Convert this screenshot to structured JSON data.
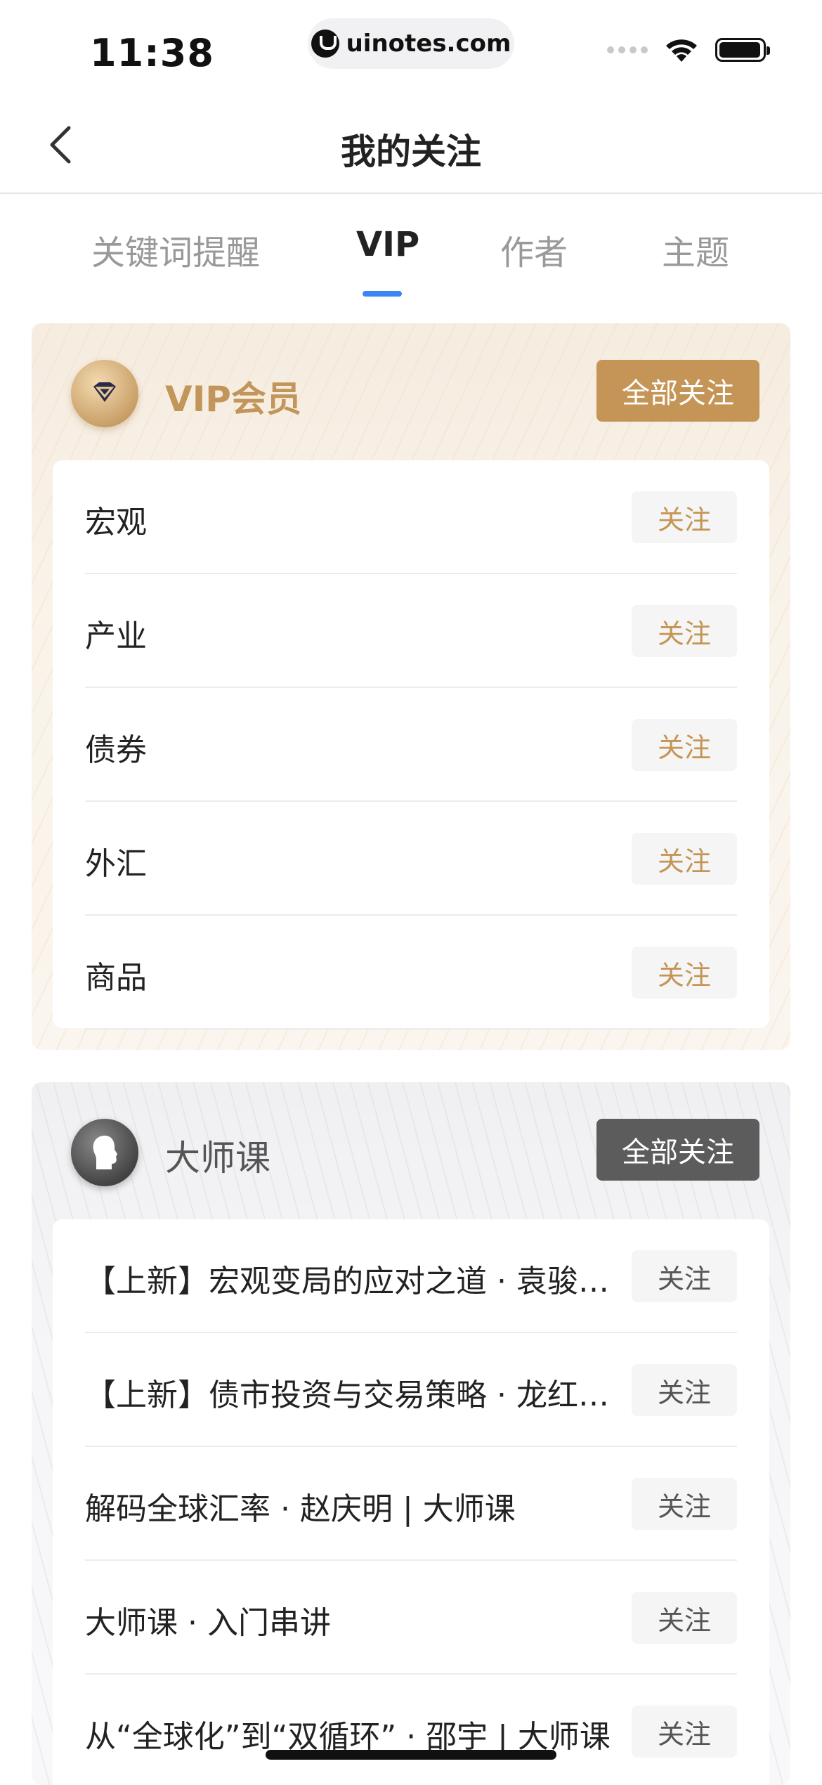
{
  "status_bar": {
    "time": "11:38",
    "url": "uinotes.com"
  },
  "nav": {
    "title": "我的关注"
  },
  "tabs": [
    {
      "label": "关键词提醒",
      "active": false
    },
    {
      "label": "VIP",
      "active": true
    },
    {
      "label": "作者",
      "active": false
    },
    {
      "label": "主题",
      "active": false
    }
  ],
  "vip_section": {
    "title": "VIP会员",
    "follow_all_label": "全部关注",
    "items": [
      {
        "label": "宏观",
        "button": "关注"
      },
      {
        "label": "产业",
        "button": "关注"
      },
      {
        "label": "债券",
        "button": "关注"
      },
      {
        "label": "外汇",
        "button": "关注"
      },
      {
        "label": "商品",
        "button": "关注"
      }
    ]
  },
  "master_section": {
    "title": "大师课",
    "follow_all_label": "全部关注",
    "items": [
      {
        "label": "【上新】宏观变局的应对之道 · 袁骏…",
        "button": "关注"
      },
      {
        "label": "【上新】债市投资与交易策略 · 龙红…",
        "button": "关注"
      },
      {
        "label": "解码全球汇率 · 赵庆明 | 大师课",
        "button": "关注"
      },
      {
        "label": "大师课 · 入门串讲",
        "button": "关注"
      },
      {
        "label": "从“全球化”到“双循环” · 邵宇 | 大师课",
        "button": "关注"
      }
    ]
  },
  "colors": {
    "accent_blue": "#3a86f3",
    "vip_gold": "#c49556",
    "master_gray": "#5c5c5c"
  }
}
